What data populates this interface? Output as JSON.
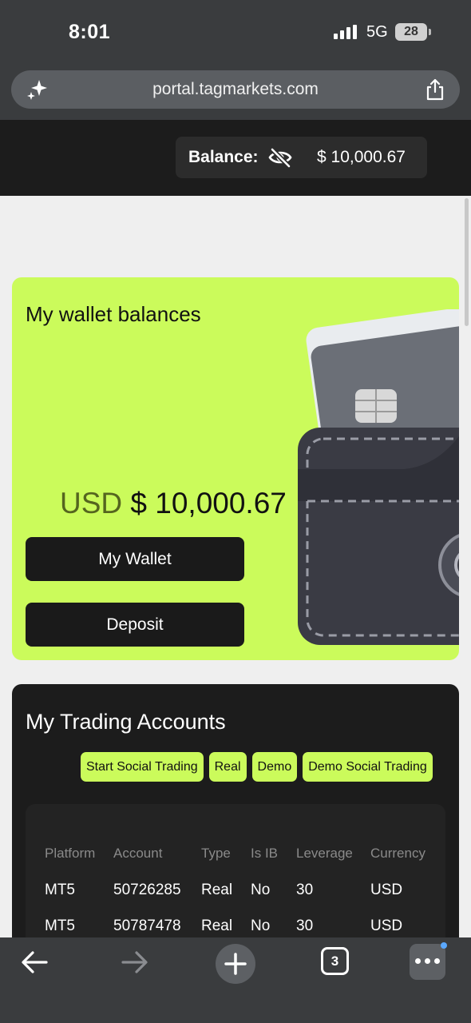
{
  "status_bar": {
    "time": "8:01",
    "network": "5G",
    "battery": "28"
  },
  "browser": {
    "url": "portal.tagmarkets.com",
    "tab_count": "3"
  },
  "header": {
    "balance_label": "Balance:",
    "balance_value": "$ 10,000.67"
  },
  "wallet": {
    "title": "My wallet balances",
    "currency": "USD",
    "amount": "$ 10,000.67",
    "my_wallet_button": "My Wallet",
    "deposit_button": "Deposit"
  },
  "trading": {
    "title": "My Trading Accounts",
    "chips": [
      "Start Social Trading",
      "Real",
      "Demo",
      "Demo Social Trading"
    ],
    "columns": [
      "Platform",
      "Account",
      "Type",
      "Is IB",
      "Leverage",
      "Currency"
    ],
    "rows": [
      [
        "MT5",
        "50726285",
        "Real",
        "No",
        "30",
        "USD"
      ],
      [
        "MT5",
        "50787478",
        "Real",
        "No",
        "30",
        "USD"
      ]
    ]
  },
  "colors": {
    "accent": "#cbfb5b",
    "dark": "#1c1c1c"
  }
}
